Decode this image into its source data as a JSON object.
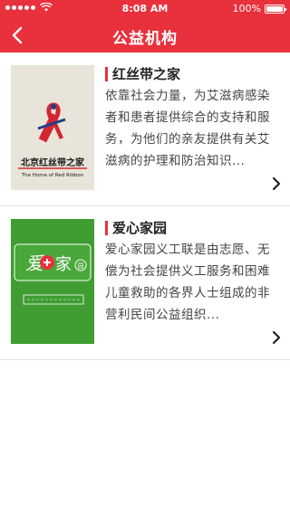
{
  "status_bar": {
    "time": "8:08 AM",
    "battery_percent": "100%"
  },
  "nav": {
    "title": "公益机构",
    "back_icon": "chevron-left-icon"
  },
  "colors": {
    "brand_red": "#e8313d",
    "divider": "#e2e2e2"
  },
  "organizations": [
    {
      "name": "红丝带之家",
      "description": "依靠社会力量，为艾滋病感染者和患者提供综合的支持和服务，为他们的亲友提供有关艾滋病的护理和防治知识...",
      "logo_icon": "red-ribbon-logo-icon"
    },
    {
      "name": "爱心家园",
      "description": "爱心家园义工联是由志愿、无偿为社会提供义工服务和困难儿童救助的各界人士组成的非营利民间公益组织...",
      "logo_icon": "love-home-logo-icon"
    }
  ]
}
